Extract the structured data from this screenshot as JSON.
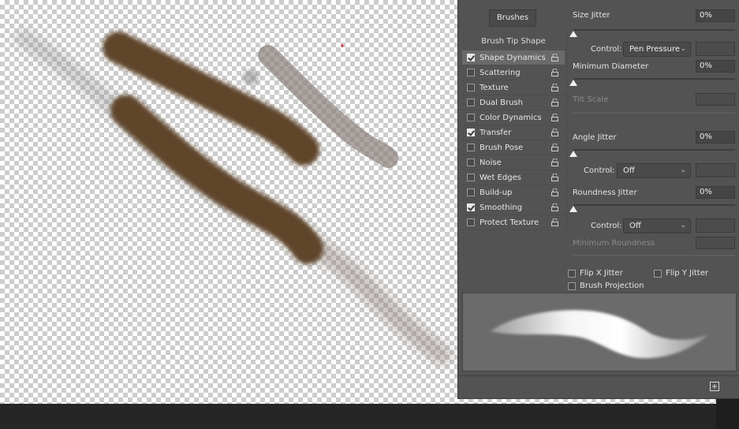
{
  "panel": {
    "brushes_button": "Brushes",
    "brush_tip_shape": "Brush Tip Shape",
    "options": [
      {
        "label": "Shape Dynamics",
        "checked": true,
        "selected": true
      },
      {
        "label": "Scattering",
        "checked": false
      },
      {
        "label": "Texture",
        "checked": false
      },
      {
        "label": "Dual Brush",
        "checked": false
      },
      {
        "label": "Color Dynamics",
        "checked": false
      },
      {
        "label": "Transfer",
        "checked": true
      },
      {
        "label": "Brush Pose",
        "checked": false
      },
      {
        "label": "Noise",
        "checked": false
      },
      {
        "label": "Wet Edges",
        "checked": false
      },
      {
        "label": "Build-up",
        "checked": false
      },
      {
        "label": "Smoothing",
        "checked": true
      },
      {
        "label": "Protect Texture",
        "checked": false
      }
    ],
    "settings": {
      "size_jitter_label": "Size Jitter",
      "size_jitter_value": "0%",
      "control_label": "Control:",
      "size_control_value": "Pen Pressure",
      "minimum_diameter_label": "Minimum Diameter",
      "minimum_diameter_value": "0%",
      "tilt_scale_label": "Tilt Scale",
      "angle_jitter_label": "Angle Jitter",
      "angle_jitter_value": "0%",
      "angle_control_value": "Off",
      "roundness_jitter_label": "Roundness Jitter",
      "roundness_jitter_value": "0%",
      "roundness_control_value": "Off",
      "minimum_roundness_label": "Minimum Roundness",
      "flip_x_label": "Flip X Jitter",
      "flip_y_label": "Flip Y Jitter",
      "brush_projection_label": "Brush Projection"
    }
  },
  "icons": {
    "checkbox": "checkbox-icon",
    "lock": "lock-icon",
    "chevron": "chevron-down-icon",
    "new_preset": "new-preset-icon"
  },
  "colors": {
    "stroke_dark": "#5e4529",
    "panel_bg": "#535353",
    "selected_row": "#6a6a6a"
  }
}
